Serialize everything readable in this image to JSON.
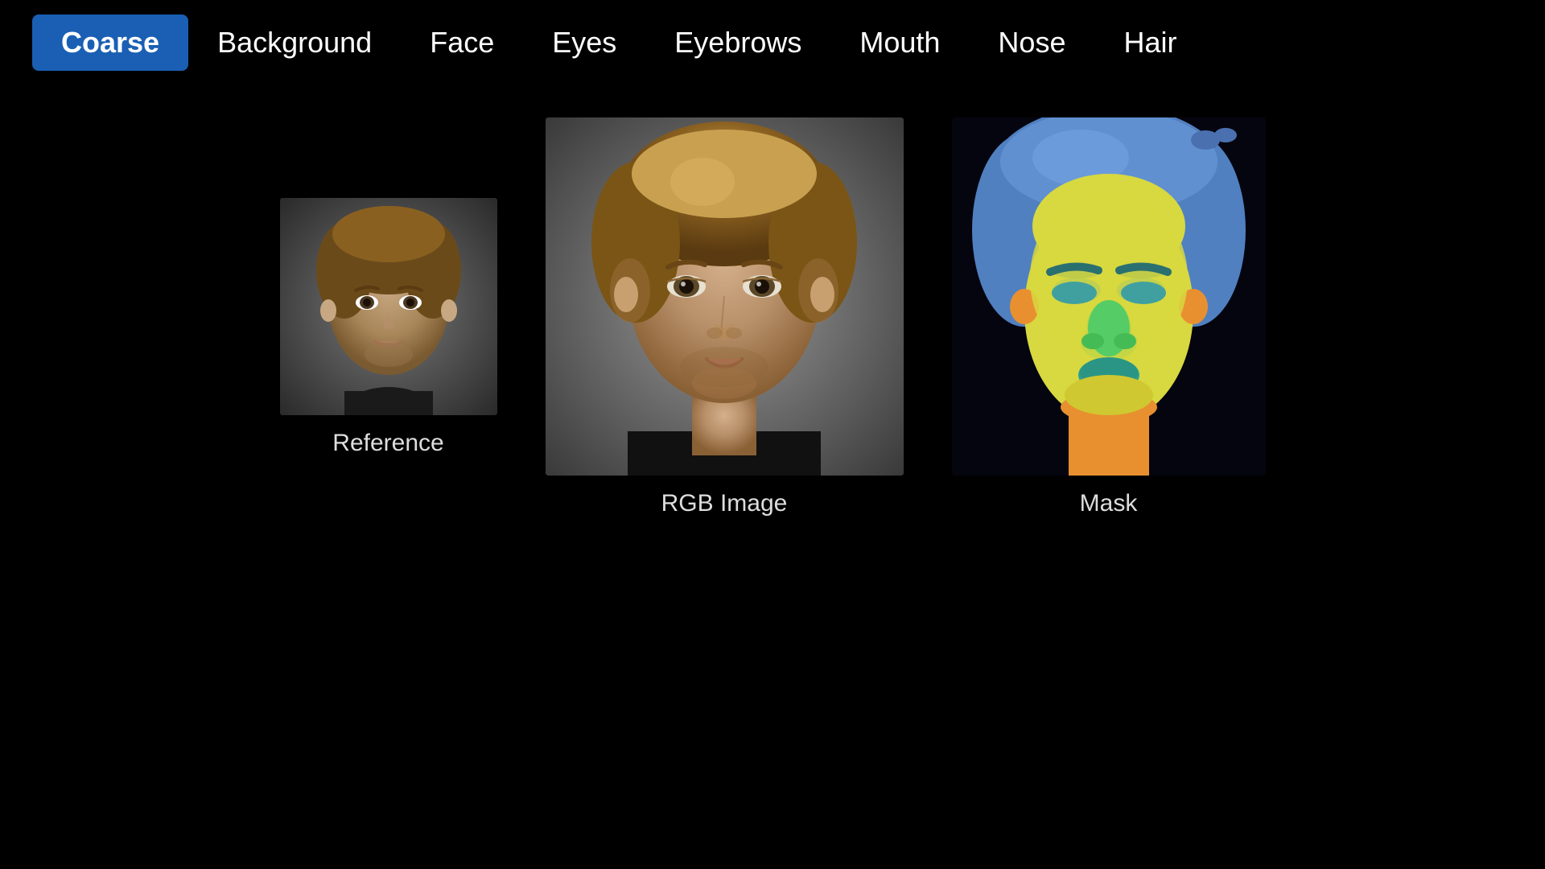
{
  "nav": {
    "tabs": [
      {
        "label": "Coarse",
        "active": true
      },
      {
        "label": "Background",
        "active": false
      },
      {
        "label": "Face",
        "active": false
      },
      {
        "label": "Eyes",
        "active": false
      },
      {
        "label": "Eyebrows",
        "active": false
      },
      {
        "label": "Mouth",
        "active": false
      },
      {
        "label": "Nose",
        "active": false
      },
      {
        "label": "Hair",
        "active": false
      }
    ]
  },
  "panels": {
    "reference_label": "Reference",
    "rgb_label": "RGB Image",
    "mask_label": "Mask"
  },
  "colors": {
    "active_tab_bg": "#1a5fb4",
    "background": "#000000"
  }
}
